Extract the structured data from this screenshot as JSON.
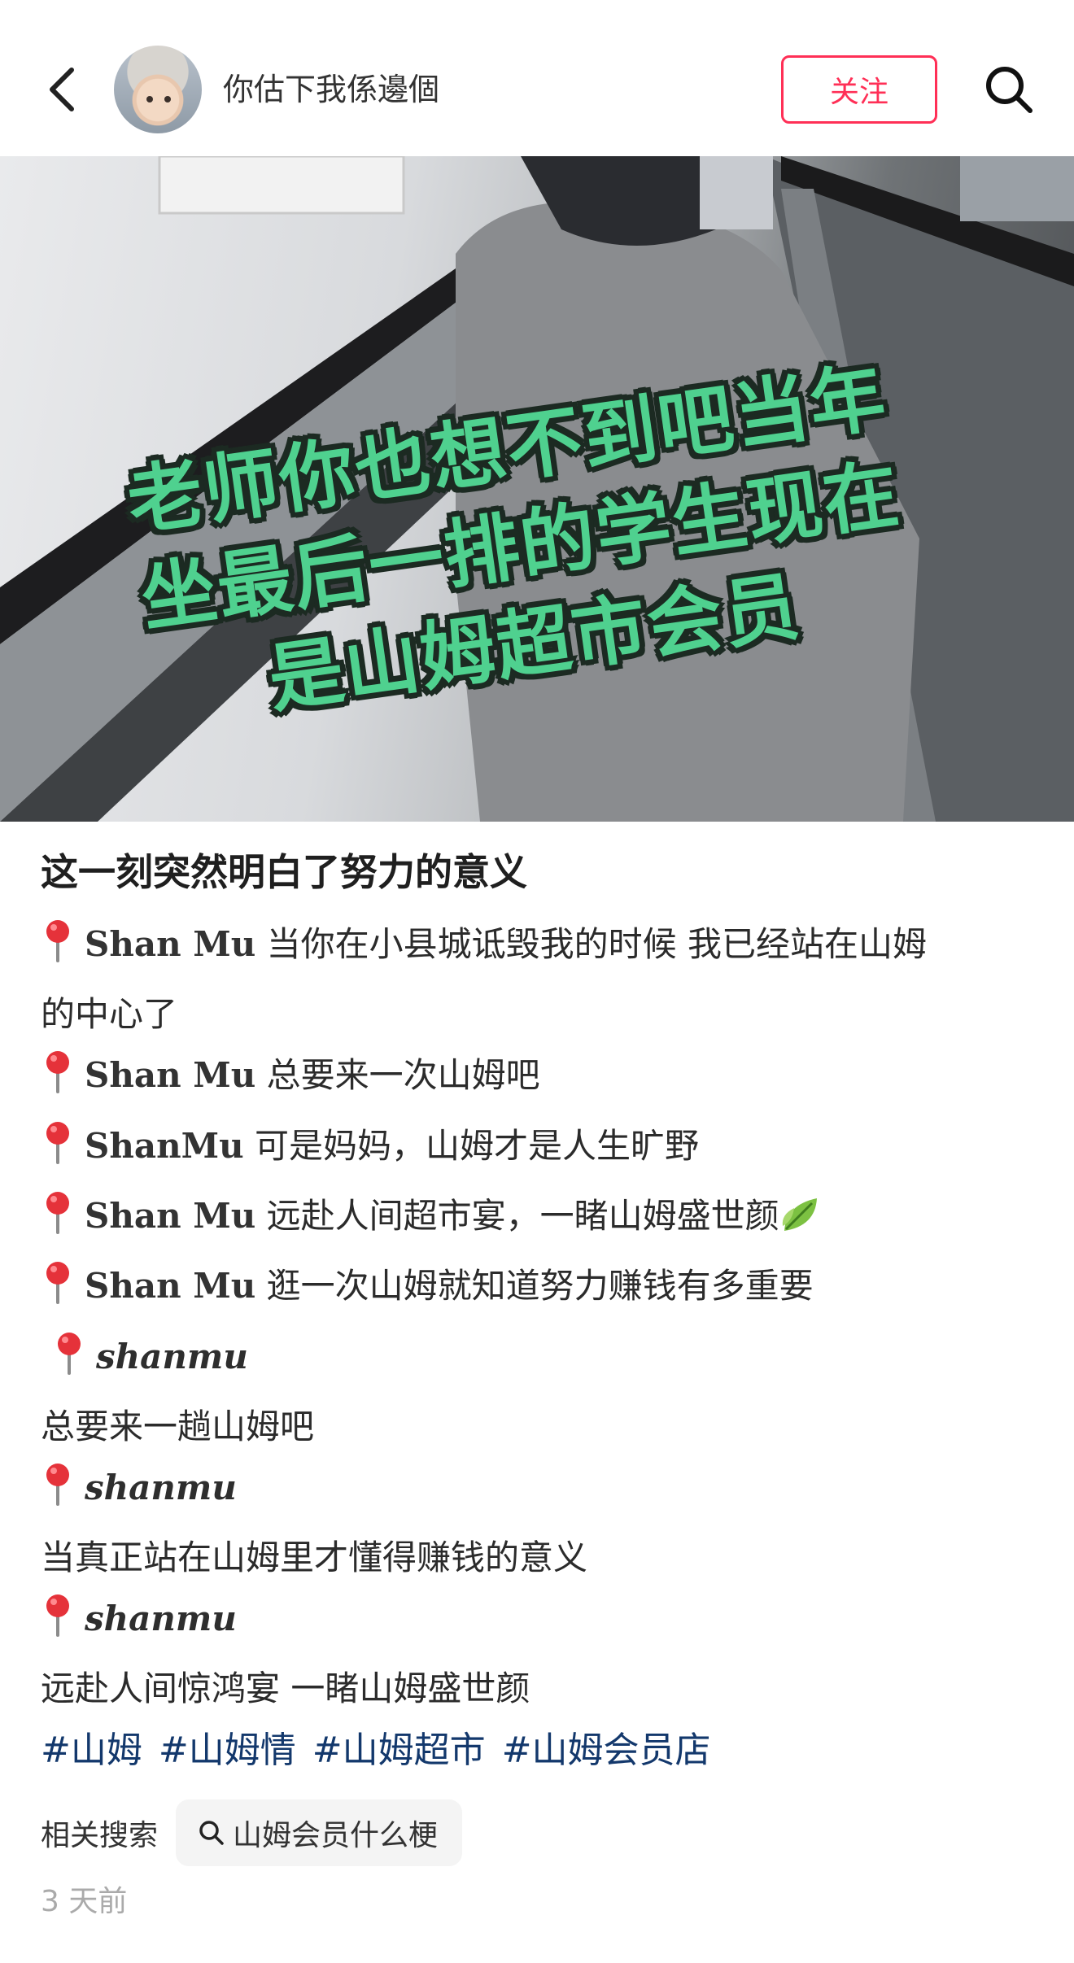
{
  "header": {
    "author_name": "你估下我係邊個",
    "follow_label": "关注",
    "icons": {
      "back": "chevron-left-icon",
      "search": "search-icon"
    }
  },
  "media": {
    "overlay_lines": [
      "老师你也想不到吧当年",
      "坐最后一排的学生现在",
      "是山姆超市会员"
    ],
    "icons": {
      "scan": "image-search-icon",
      "play": "play-icon"
    },
    "overlay_color": "#4fd18f"
  },
  "post": {
    "title": "这一刻突然明白了努力的意义",
    "lines": [
      {
        "brand": "Shan Mu",
        "text": "当你在小县城诋毁我的时候 我已经站在山姆"
      },
      {
        "text": "的中心了"
      },
      {
        "brand": "Shan Mu",
        "text": "总要来一次山姆吧"
      },
      {
        "brand": "ShanMu",
        "text": "可是妈妈，山姆才是人生旷野"
      },
      {
        "brand": "Shan Mu",
        "text": "远赴人间超市宴，一睹山姆盛世颜"
      },
      {
        "brand": "Shan Mu",
        "text": "逛一次山姆就知道努力赚钱有多重要"
      },
      {
        "brand": "shanmu"
      },
      {
        "text": "总要来一趟山姆吧"
      },
      {
        "brand": "shanmu"
      },
      {
        "text": "当真正站在山姆里才懂得赚钱的意义"
      },
      {
        "brand": "shanmu"
      },
      {
        "text": "远赴人间惊鸿宴 一睹山姆盛世颜"
      }
    ],
    "tags": [
      "#山姆",
      "#山姆情",
      "#山姆超市",
      "#山姆会员店"
    ],
    "related_label": "相关搜索",
    "related_query": "山姆会员什么梗",
    "timestamp": "3 天前"
  },
  "colors": {
    "follow": "#ff2f56",
    "tag": "#13386c",
    "timestamp": "#aaaaaa"
  }
}
